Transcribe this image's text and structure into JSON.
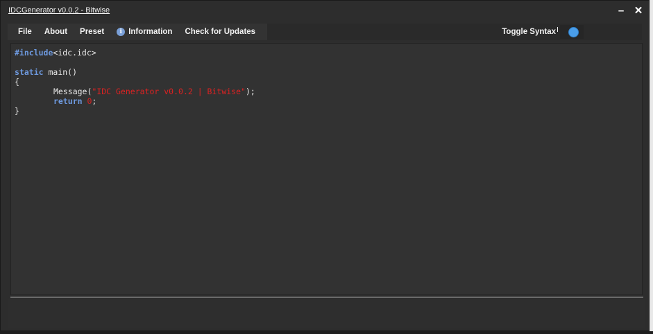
{
  "window": {
    "title": "IDCGenerator v0.0.2 - Bitwise",
    "minimize_glyph": "–",
    "close_glyph": "✕"
  },
  "menu": {
    "items": [
      {
        "label": "File"
      },
      {
        "label": "About"
      },
      {
        "label": "Preset"
      },
      {
        "label": "Information",
        "icon": "info-icon"
      },
      {
        "label": "Check for Updates"
      }
    ],
    "info_glyph": "i",
    "toggle_label": "Toggle Syntax",
    "toggle_on": true
  },
  "editor": {
    "include_kw": "#include",
    "include_target": "<idc.idc>",
    "static_kw": "static",
    "func_sig": " main()",
    "open_brace": "{",
    "message_call": "Message(",
    "message_str": "\"IDC Generator v0.0.2 | Bitwise\"",
    "message_end": ");",
    "return_kw": "return",
    "return_val": "0",
    "return_end": ";",
    "close_brace": "}"
  },
  "colors": {
    "keyword": "#6e9ae0",
    "string": "#dd2222",
    "toggle_knob": "#4a9eea"
  }
}
